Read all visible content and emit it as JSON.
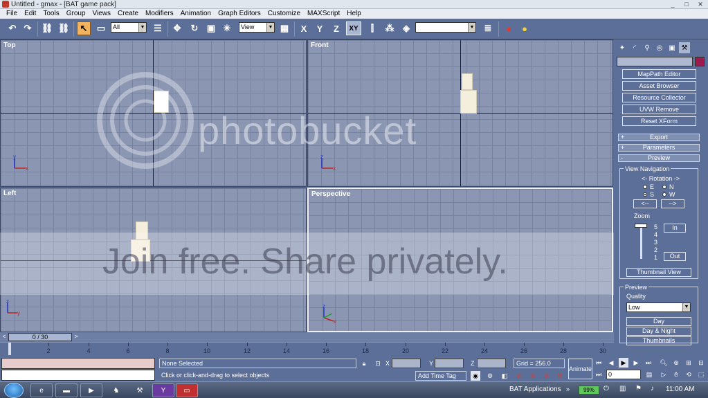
{
  "window": {
    "title": "Untitled - gmax - [BAT game pack]",
    "controls": [
      "_",
      "□",
      "✕"
    ]
  },
  "menu": [
    "File",
    "Edit",
    "Tools",
    "Group",
    "Views",
    "Create",
    "Modifiers",
    "Animation",
    "Graph Editors",
    "Customize",
    "MAXScript",
    "Help"
  ],
  "toolbar": {
    "selection_filter": "All",
    "reference_coord": "View",
    "axis_x": "X",
    "axis_y": "Y",
    "axis_z": "Z",
    "axis_xy": "XY",
    "named_selection": ""
  },
  "viewports": {
    "top": "Top",
    "front": "Front",
    "left": "Left",
    "perspective": "Perspective"
  },
  "watermark": {
    "word": "photobucket",
    "join": "Join free. Share privately."
  },
  "command_panel": {
    "utility_buttons": [
      "MapPath Editor",
      "Asset Browser",
      "Resource Collector",
      "UVW Remove",
      "Reset XForm"
    ],
    "rollouts": [
      {
        "sign": "+",
        "label": "Export"
      },
      {
        "sign": "+",
        "label": "Parameters"
      },
      {
        "sign": "-",
        "label": "Preview"
      }
    ],
    "view_navigation": {
      "title": "View Navigation",
      "rotation_label": "<- Rotation ->",
      "radio_e": "E",
      "radio_n": "N",
      "radio_s": "S",
      "radio_w": "W",
      "rotate_left": "<--",
      "rotate_right": "-->",
      "zoom_label": "Zoom",
      "zoom_levels": [
        "5",
        "4",
        "3",
        "2",
        "1"
      ],
      "zoom_in": "In",
      "zoom_out": "Out",
      "thumbnail_view": "Thumbnail View"
    },
    "preview": {
      "title": "Preview",
      "quality_label": "Quality",
      "quality_value": "Low",
      "buttons": [
        "Day",
        "Day & Night",
        "Thumbnails"
      ]
    }
  },
  "timeline": {
    "frame_display": "0 / 30",
    "ticks": [
      "2",
      "4",
      "6",
      "8",
      "10",
      "12",
      "14",
      "16",
      "18",
      "20",
      "22",
      "24",
      "26",
      "28",
      "30"
    ]
  },
  "status": {
    "selection": "None Selected",
    "prompt": "Click or click-and-drag to select objects",
    "x_label": "X",
    "y_label": "Y",
    "z_label": "Z",
    "grid": "Grid = 256.0",
    "add_time_tag": "Add Time Tag",
    "animate": "Animate",
    "frame_value": "0"
  },
  "taskbar": {
    "tray_app": "BAT Applications",
    "battery": "99%",
    "clock": "11:00 AM"
  }
}
